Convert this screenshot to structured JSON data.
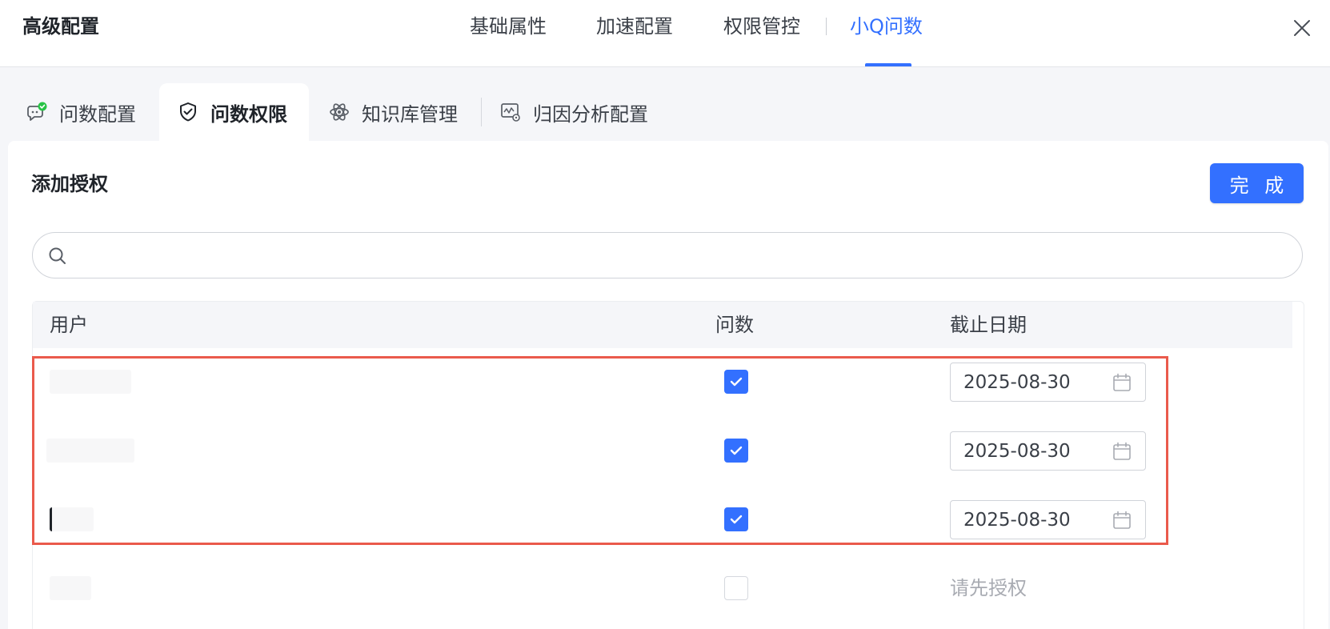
{
  "header": {
    "title": "高级配置",
    "tabs": [
      {
        "label": "基础属性"
      },
      {
        "label": "加速配置"
      },
      {
        "label": "权限管控"
      },
      {
        "label": "小Q问数"
      }
    ],
    "active_tab": "小Q问数"
  },
  "sub_tabs": [
    {
      "label": "问数配置",
      "icon": "chat-bubble-check-icon"
    },
    {
      "label": "问数权限",
      "icon": "shield-check-icon"
    },
    {
      "label": "知识库管理",
      "icon": "atom-icon"
    },
    {
      "label": "归因分析配置",
      "icon": "chart-gear-icon"
    }
  ],
  "active_sub_tab": "问数权限",
  "section": {
    "title": "添加授权",
    "done_label": "完 成"
  },
  "search": {
    "value": "",
    "placeholder": ""
  },
  "table": {
    "columns": {
      "user": "用户",
      "ask": "问数",
      "deadline": "截止日期"
    },
    "rows": [
      {
        "checked": true,
        "deadline": "2025-08-30"
      },
      {
        "checked": true,
        "deadline": "2025-08-30"
      },
      {
        "checked": true,
        "deadline": "2025-08-30"
      },
      {
        "checked": false,
        "hint": "请先授权"
      }
    ]
  },
  "colors": {
    "accent": "#3370ff",
    "highlight": "#ea5a4c",
    "status_green": "#27c346"
  }
}
